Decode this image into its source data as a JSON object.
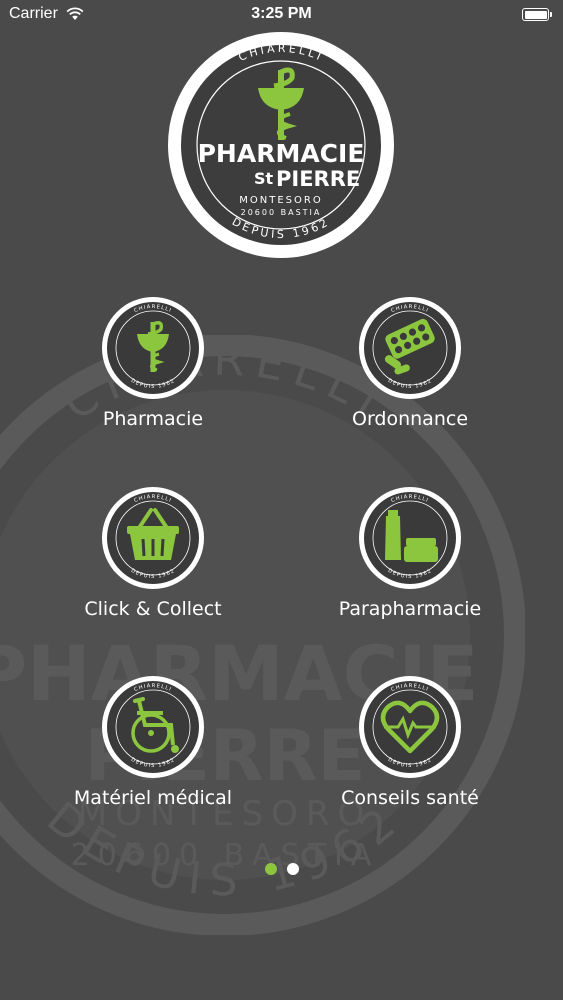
{
  "status_bar": {
    "carrier": "Carrier",
    "time": "3:25 PM",
    "battery_level": 1.0,
    "icons": [
      "wifi-icon",
      "battery-icon"
    ]
  },
  "logo": {
    "top_text": "CHIARELLI",
    "name_line1": "PHARMACIE",
    "name_line2_abbrev": "St",
    "name_line2": "PIERRE",
    "locality": "MONTESORO",
    "postal": "20600 BASTIA",
    "bottom_text": "DEPUIS 1962",
    "emblem": "caduceus-icon"
  },
  "badge": {
    "top_text": "CHIARELLI",
    "bottom_text": "DEPUIS 1962"
  },
  "menu": {
    "items": [
      {
        "label": "Pharmacie",
        "icon": "caduceus-icon"
      },
      {
        "label": "Ordonnance",
        "icon": "pills-icon"
      },
      {
        "label": "Click & Collect",
        "icon": "basket-icon"
      },
      {
        "label": "Parapharmacie",
        "icon": "cosmetics-icon"
      },
      {
        "label": "Matériel médical",
        "icon": "wheelchair-icon"
      },
      {
        "label": "Conseils santé",
        "icon": "heart-pulse-icon"
      }
    ]
  },
  "pagination": {
    "pages": 2,
    "current": 1
  },
  "colors": {
    "background": "#4a4a4b",
    "accent_green": "#8cc63f",
    "badge_bg": "#3a3a3a",
    "white": "#ffffff"
  }
}
